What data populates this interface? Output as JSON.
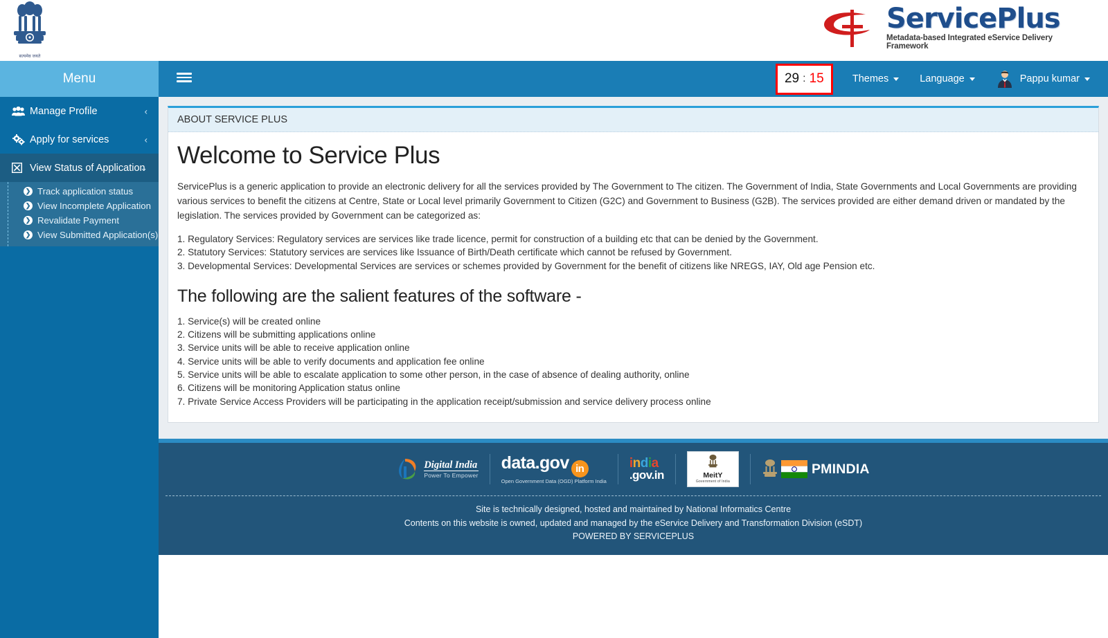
{
  "brand": {
    "emblem_motto": "सत्यमेव जयते",
    "logo_word": "ServicePlus",
    "logo_tagline": "Metadata-based Integrated eService Delivery Framework"
  },
  "sidebar": {
    "menu_label": "Menu",
    "items": [
      {
        "label": "Manage Profile",
        "icon": "users-icon",
        "chevron": "‹",
        "active": false
      },
      {
        "label": "Apply for services",
        "icon": "gears-icon",
        "chevron": "‹",
        "active": false
      },
      {
        "label": "View Status of Application",
        "icon": "boxed-x-icon",
        "chevron": "⌄",
        "active": true
      }
    ],
    "submenu": [
      {
        "label": "Track application status"
      },
      {
        "label": "View Incomplete Application"
      },
      {
        "label": "Revalidate Payment"
      },
      {
        "label": "View Submitted Application(s)"
      }
    ]
  },
  "topnav": {
    "timer": {
      "minutes": "29",
      "separator": ":",
      "seconds": "15"
    },
    "themes_label": "Themes",
    "language_label": "Language",
    "user_name": "Pappu kumar"
  },
  "main": {
    "card_title": "ABOUT SERVICE PLUS",
    "heading": "Welcome to Service Plus",
    "intro": "ServicePlus is a generic application to provide an electronic delivery for all the services provided by The Government to The citizen. The Government of India, State Governments and Local Governments are providing various services to benefit the citizens at Centre, State or Local level primarily Government to Citizen (G2C) and Government to Business (G2B). The services provided are either demand driven or mandated by the legislation. The services provided by Government can be categorized as:",
    "categories": [
      "1. Regulatory Services: Regulatory services are services like trade licence, permit for construction of a building etc that can be denied by the Government.",
      "2. Statutory Services: Statutory services are services like Issuance of Birth/Death certificate which cannot be refused by Government.",
      "3. Developmental Services: Developmental Services are services or schemes provided by Government for the benefit of citizens like NREGS, IAY, Old age Pension etc."
    ],
    "features_heading": "The following are the salient features of the software -",
    "features": [
      "1. Service(s) will be created online",
      "2. Citizens will be submitting applications online",
      "3. Service units will be able to receive application online",
      "4. Service units will be able to verify documents and application fee online",
      "5. Service units will be able to escalate application to some other person, in the case of absence of dealing authority, online",
      "6. Citizens will be monitoring Application status online",
      "7. Private Service Access Providers will be participating in the application receipt/submission and service delivery process online"
    ]
  },
  "footer": {
    "logos": {
      "digital_india_line1": "Digital India",
      "digital_india_line2": "Power To Empower",
      "datagov_main": "data.gov",
      "datagov_in": "in",
      "datagov_sub": "Open Government Data (OGD) Platform India",
      "indiagov_line1": "india",
      "indiagov_line2": ".gov.in",
      "meity_title": "MeitY",
      "meity_sub": "Government of India",
      "pmindia": "PMINDIA"
    },
    "lines": [
      "Site is technically designed, hosted and maintained by National Informatics Centre",
      "Contents on this website is owned, updated and managed by the eService Delivery and Transformation Division (eSDT)",
      "POWERED BY SERVICEPLUS"
    ]
  },
  "colors": {
    "sidebar_blue": "#0a6ca4",
    "sidebar_head_blue": "#5bb4e0",
    "topnav_blue": "#1a7db5",
    "submenu_blue": "#2a7098",
    "active_item_blue": "#1c5d83",
    "footer_blue": "#22557a",
    "footer_top_bar": "#2b8cc4",
    "timer_alert_red": "#ff0000",
    "card_accent": "#2b9fd9"
  }
}
